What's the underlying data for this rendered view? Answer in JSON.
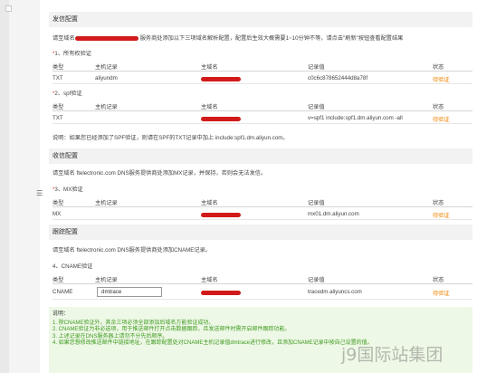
{
  "sidebar": {
    "toggle_glyph": "☰"
  },
  "sections": {
    "send": {
      "title": "发信配置",
      "desc_prefix": "请至域名",
      "desc_suffix": "服务商处添加以下三项域名解析配置，配置后生效大概需要1~10分钟不等，请点击\"刷新\"按钮查看配置结果",
      "ownership": {
        "title_num": "1、所有权验证",
        "headers": [
          "类型",
          "主机记录",
          "主域名",
          "记录值",
          "状态"
        ],
        "row": {
          "type": "TXT",
          "host": "aliyundm",
          "value": "c0c6c878652444d8a78f",
          "status": "待验证"
        }
      },
      "spf": {
        "title_num": "2、spf验证",
        "headers": [
          "类型",
          "主机记录",
          "主域名",
          "记录值",
          "状态"
        ],
        "row": {
          "type": "TXT",
          "host": "",
          "value": "v=spf1 include:spf1.dm.aliyun.com -all",
          "status": "待验证"
        },
        "note": "说明：如果您已经添加了SPF验证，则请在SPF的TXT记录中加上 include:spf1.dm.aliyun.com。"
      }
    },
    "receive": {
      "title": "收信配置",
      "desc": "请至域名 ftelectronic.com DNS服务提供商处添加MX记录，并保持，否则会无法发信。",
      "mx": {
        "title_num": "3、MX验证",
        "headers": [
          "类型",
          "主机记录",
          "主域名",
          "记录值",
          "状态"
        ],
        "row": {
          "type": "MX",
          "host": "",
          "value": "mx01.dm.aliyun.com",
          "status": "待验证"
        }
      }
    },
    "track": {
      "title": "跟踪配置",
      "desc": "请至域名 ftelectronic.com DNS服务提供商处添加CNAME记录。",
      "cname": {
        "title_num": "4、CNAME验证",
        "headers": [
          "类型",
          "主机记录",
          "主域名",
          "记录值",
          "状态"
        ],
        "row": {
          "type": "CNAME",
          "host_input": "dmtrace",
          "value": "tracedm.aliyuncs.com",
          "status": "待验证"
        }
      }
    }
  },
  "notes": {
    "title": "说明：",
    "items": [
      "1. 除CNAME验证外，其余三项必须全部添加后域名方能验证成功。",
      "2. CNAME验证为非必选项，用于推送邮件打开点击数据跟踪，且发送邮件时需开启邮件跟踪功能。",
      "3. 上述记录在DNS服务器上请勿不分先后顺序。",
      "4. 如果您想修改推送邮件中链接地址，在跟踪配置处对CNAME主机记录值dmtrace进行修改，且添加CNAME记录中按自己设置的值。"
    ]
  },
  "watermark": "j9国际站集团",
  "colors": {
    "pending": "#f08300",
    "required_star": "#e4393c",
    "note_text": "#3d9a1f",
    "note_bg": "#eef8e6",
    "redaction": "#d21a1a"
  }
}
